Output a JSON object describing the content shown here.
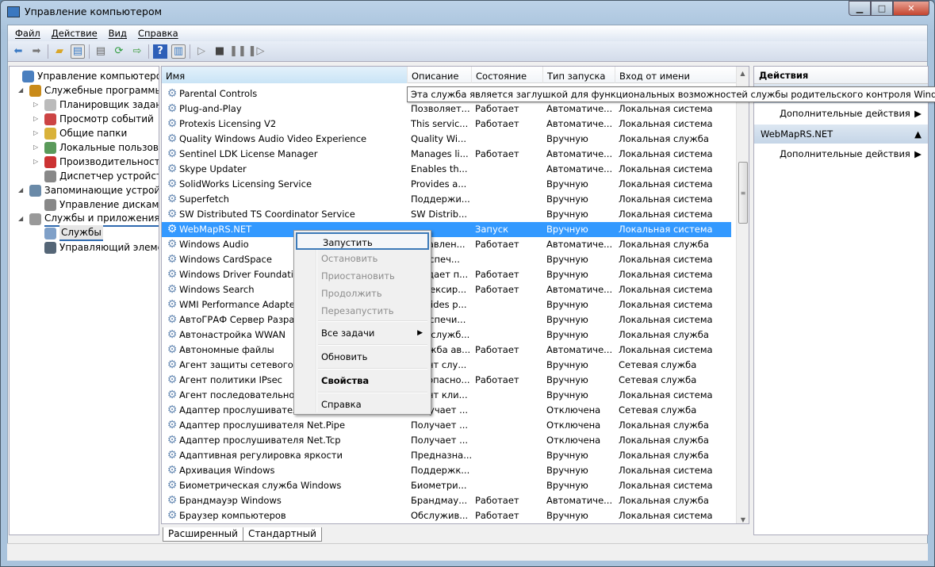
{
  "window": {
    "title": "Управление компьютером",
    "minimize": "▁",
    "maximize": "□",
    "close": "✕"
  },
  "menu": [
    "Файл",
    "Действие",
    "Вид",
    "Справка"
  ],
  "toolbar": [
    "back-icon",
    "forward-icon",
    "up-folder-icon",
    "show-tree-icon",
    "export-list-icon",
    "refresh-icon",
    "export-icon",
    "help-icon",
    "show-action-pane-icon",
    "start-service-icon",
    "stop-service-icon",
    "pause-service-icon",
    "restart-service-icon"
  ],
  "tree": [
    {
      "label": "Управление компьютером (л",
      "level": 0,
      "icon": "computer-icon",
      "exp": ""
    },
    {
      "label": "Служебные программы",
      "level": 1,
      "icon": "tools-icon",
      "exp": "◢"
    },
    {
      "label": "Планировщик заданий",
      "level": 2,
      "icon": "clock-icon",
      "exp": "▷"
    },
    {
      "label": "Просмотр событий",
      "level": 2,
      "icon": "event-viewer-icon",
      "exp": "▷"
    },
    {
      "label": "Общие папки",
      "level": 2,
      "icon": "shared-folders-icon",
      "exp": "▷"
    },
    {
      "label": "Локальные пользовате",
      "level": 2,
      "icon": "users-icon",
      "exp": "▷"
    },
    {
      "label": "Производительность",
      "level": 2,
      "icon": "performance-icon",
      "exp": "▷"
    },
    {
      "label": "Диспетчер устройств",
      "level": 2,
      "icon": "device-manager-icon",
      "exp": ""
    },
    {
      "label": "Запоминающие устройст",
      "level": 1,
      "icon": "storage-icon",
      "exp": "◢"
    },
    {
      "label": "Управление дисками",
      "level": 2,
      "icon": "disk-icon",
      "exp": ""
    },
    {
      "label": "Службы и приложения",
      "level": 1,
      "icon": "services-apps-icon",
      "exp": "◢"
    },
    {
      "label": "Службы",
      "level": 2,
      "icon": "gear-icon",
      "exp": ""
    },
    {
      "label": "Управляющий элемен",
      "level": 2,
      "icon": "wmi-icon",
      "exp": ""
    }
  ],
  "columns": [
    "Имя",
    "Описание",
    "Состояние",
    "Тип запуска",
    "Вход от имени"
  ],
  "rows": [
    [
      "Parental Controls",
      "",
      "",
      "",
      ""
    ],
    [
      "Plug-and-Play",
      "Позволяет...",
      "Работает",
      "Автоматиче...",
      "Локальная система"
    ],
    [
      "Protexis Licensing V2",
      "This servic...",
      "Работает",
      "Автоматиче...",
      "Локальная система"
    ],
    [
      "Quality Windows Audio Video Experience",
      "Quality Wi...",
      "",
      "Вручную",
      "Локальная служба"
    ],
    [
      "Sentinel LDK License Manager",
      "Manages li...",
      "Работает",
      "Автоматиче...",
      "Локальная система"
    ],
    [
      "Skype Updater",
      "Enables th...",
      "",
      "Автоматиче...",
      "Локальная система"
    ],
    [
      "SolidWorks Licensing Service",
      "Provides a...",
      "",
      "Вручную",
      "Локальная система"
    ],
    [
      "Superfetch",
      "Поддержи...",
      "",
      "Вручную",
      "Локальная система"
    ],
    [
      "SW Distributed TS Coordinator Service",
      "SW Distrib...",
      "",
      "Вручную",
      "Локальная система"
    ],
    [
      "WebMapRS.NET",
      "",
      "Запуск",
      "Вручную",
      "Локальная система"
    ],
    [
      "Windows Audio",
      "Управлен...",
      "Работает",
      "Автоматиче...",
      "Локальная служба"
    ],
    [
      "Windows CardSpace",
      "Обеспеч...",
      "",
      "Вручную",
      "Локальная система"
    ],
    [
      "Windows Driver Foundation",
      "Создает п...",
      "Работает",
      "Вручную",
      "Локальная система"
    ],
    [
      "Windows Search",
      "Индексир...",
      "Работает",
      "Автоматиче...",
      "Локальная система"
    ],
    [
      "WMI Performance Adapter",
      "Provides p...",
      "",
      "Вручную",
      "Локальная система"
    ],
    [
      "АвтоГРАФ Сервер Разрабо",
      "Обеспечи...",
      "",
      "Вручную",
      "Локальная система"
    ],
    [
      "Автонастройка WWAN",
      "Эта служб...",
      "",
      "Вручную",
      "Локальная служба"
    ],
    [
      "Автономные файлы",
      "Служба ав...",
      "Работает",
      "Автоматиче...",
      "Локальная система"
    ],
    [
      "Агент защиты сетевого до",
      "Агент слу...",
      "",
      "Вручную",
      "Сетевая служба"
    ],
    [
      "Агент политики IPsec",
      "Безопасно...",
      "Работает",
      "Вручную",
      "Сетевая служба"
    ],
    [
      "Агент последовательности",
      "Агент кли...",
      "",
      "Вручную",
      "Локальная система"
    ],
    [
      "Адаптер прослушивателя",
      "Получает ...",
      "",
      "Отключена",
      "Сетевая служба"
    ],
    [
      "Адаптер прослушивателя Net.Pipe",
      "Получает ...",
      "",
      "Отключена",
      "Локальная служба"
    ],
    [
      "Адаптер прослушивателя Net.Tcp",
      "Получает ...",
      "",
      "Отключена",
      "Локальная служба"
    ],
    [
      "Адаптивная регулировка яркости",
      "Предназна...",
      "",
      "Вручную",
      "Локальная служба"
    ],
    [
      "Архивация Windows",
      "Поддержк...",
      "",
      "Вручную",
      "Локальная система"
    ],
    [
      "Биометрическая служба Windows",
      "Биометри...",
      "",
      "Вручную",
      "Локальная система"
    ],
    [
      "Брандмауэр Windows",
      "Брандмау...",
      "Работает",
      "Автоматиче...",
      "Локальная служба"
    ],
    [
      "Браузер компьютеров",
      "Обслужив...",
      "Работает",
      "Вручную",
      "Локальная система"
    ]
  ],
  "selected_row": 9,
  "tabs": [
    "Расширенный",
    "Стандартный"
  ],
  "actions": {
    "title": "Действия",
    "section1_more": "Дополнительные действия",
    "section2": "WebMapRS.NET",
    "section2_more": "Дополнительные действия"
  },
  "tooltip": "Эта служба является заглушкой для функциональных возможностей службы родительского контроля Windows, котора",
  "context_menu": [
    {
      "label": "Запустить",
      "state": "highlighted"
    },
    {
      "label": "Остановить",
      "state": "disabled"
    },
    {
      "label": "Приостановить",
      "state": "disabled"
    },
    {
      "label": "Продолжить",
      "state": "disabled"
    },
    {
      "label": "Перезапустить",
      "state": "disabled"
    },
    {
      "label": "Все задачи",
      "state": "submenu"
    },
    {
      "label": "Обновить",
      "state": "normal"
    },
    {
      "label": "Свойства",
      "state": "bold"
    },
    {
      "label": "Справка",
      "state": "normal"
    }
  ],
  "colors": {
    "selection": "#3399ff",
    "accent": "#3d7ab8"
  }
}
